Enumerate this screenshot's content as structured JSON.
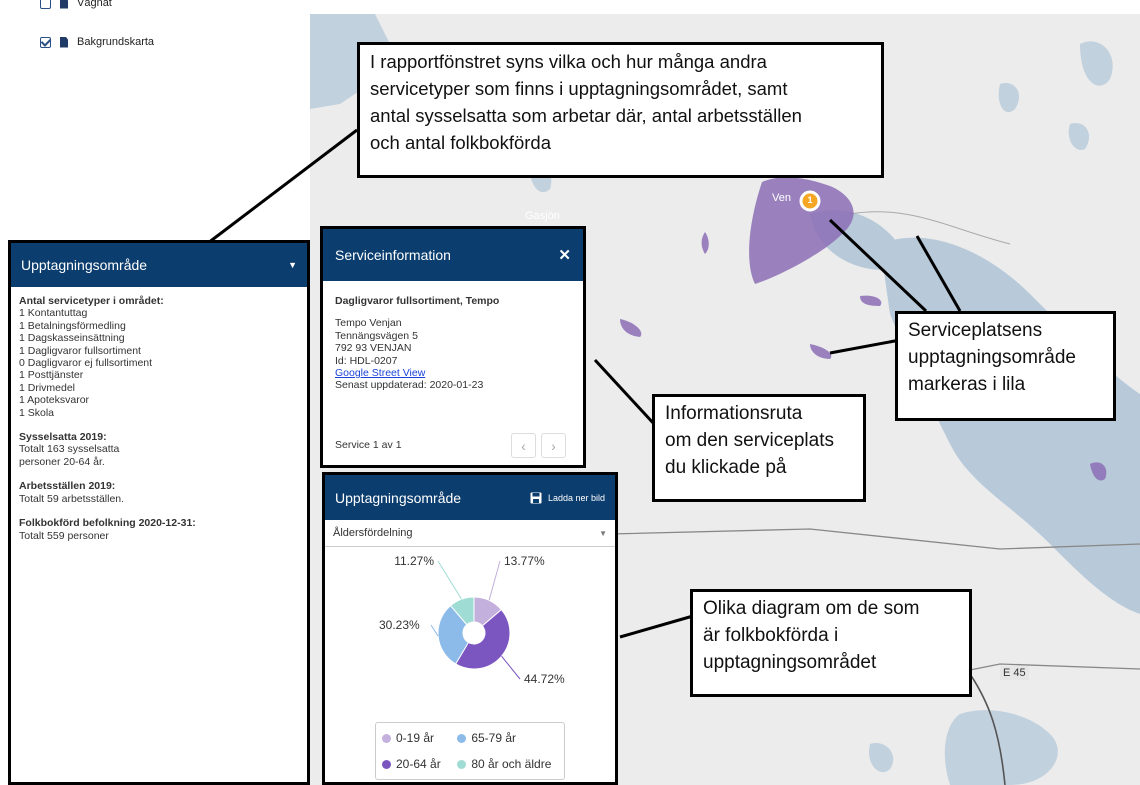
{
  "layers": [
    {
      "label": "Vägnät",
      "checked": false
    },
    {
      "label": "Bakgrundskarta",
      "checked": true
    }
  ],
  "map": {
    "place_gasjon": "Gasjön",
    "place_venjan": "Ven",
    "marker_count": "1",
    "road_label": "E 45",
    "lake_color": "#b8cad9",
    "area_color": "#8c6fb5"
  },
  "callouts": {
    "report": [
      "I rapportfönstret syns vilka och hur många andra",
      "servicetyper som finns i upptagningsområdet, samt",
      "antal sysselsatta som arbetar där, antal arbetsställen",
      "och antal folkbokförda"
    ],
    "area": [
      "Serviceplatsens",
      "upptagningsområde",
      "markeras i lila"
    ],
    "info": [
      "Informationsruta",
      "om den serviceplats",
      "du klickade på"
    ],
    "charts": [
      "Olika diagram om de som",
      "är folkbokförda i",
      "upptagningsområdet"
    ]
  },
  "left_panel": {
    "title": "Upptagningsområde",
    "caret": "▼",
    "service_heading": "Antal servicetyper i området:",
    "service_items": [
      "1 Kontantuttag",
      "1 Betalningsförmedling",
      "1 Dagskasseinsättning",
      "1 Dagligvaror fullsortiment",
      "0 Dagligvaror ej fullsortiment",
      "1 Posttjänster",
      "1 Drivmedel",
      "1 Apoteksvaror",
      "1 Skola"
    ],
    "employed_heading": "Sysselsatta 2019:",
    "employed_lines": [
      "Totalt 163 sysselsatta",
      "personer 20-64 år."
    ],
    "workplaces_heading": "Arbetsställen 2019:",
    "workplaces_line": "Totalt 59 arbetsställen.",
    "population_heading": "Folkbokförd befolkning 2020-12-31:",
    "population_line": "Totalt 559 personer"
  },
  "info_panel": {
    "title": "Serviceinformation",
    "close": "✕",
    "service_name": "Dagligvaror fullsortiment, Tempo",
    "lines": [
      "Tempo Venjan",
      "Tennängsvägen 5",
      "792 93 VENJAN",
      "Id: HDL-0207"
    ],
    "link": "Google Street View",
    "updated": "Senast uppdaterad: 2020-01-23",
    "footer": "Service 1 av 1",
    "prev": "‹",
    "next": "›"
  },
  "chart_panel": {
    "title": "Upptagningsområde",
    "download_label": "Ladda ner bild",
    "select_value": "Åldersfördelning",
    "select_caret": "▼"
  },
  "chart_data": {
    "type": "pie",
    "donut": true,
    "title": "",
    "categories": [
      "0-19 år",
      "20-64 år",
      "65-79 år",
      "80 år och äldre"
    ],
    "values": [
      13.77,
      44.72,
      30.23,
      11.27
    ],
    "labels": [
      "13.77%",
      "44.72%",
      "30.23%",
      "11.27%"
    ],
    "colors": [
      "#c4b0dc",
      "#7b55c0",
      "#8cbbea",
      "#9fdcd4"
    ],
    "legend": "bottom"
  }
}
